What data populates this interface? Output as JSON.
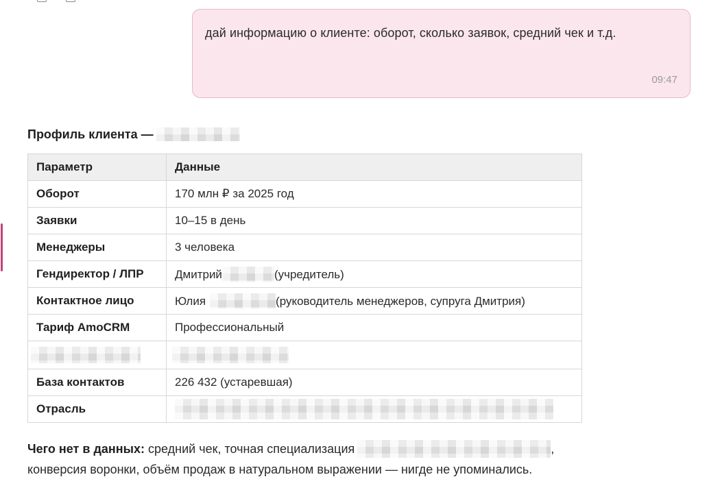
{
  "message": {
    "text": "дай информацию о клиенте: оборот, сколько заявок, средний чек и т.д.",
    "time": "09:47"
  },
  "profile": {
    "heading": "Профиль клиента —"
  },
  "table": {
    "headers": [
      "Параметр",
      "Данные"
    ],
    "rows": [
      {
        "param": "Оборот",
        "value": "170 млн ₽ за 2025 год"
      },
      {
        "param": "Заявки",
        "value": "10–15 в день"
      },
      {
        "param": "Менеджеры",
        "value": "3 человека"
      },
      {
        "param": "Гендиректор / ЛПР",
        "value_before": "Дмитрий",
        "value_after": "(учредитель)"
      },
      {
        "param": "Контактное лицо",
        "value_before": "Юлия",
        "value_after": "(руководитель менеджеров, супруга Дмитрия)"
      },
      {
        "param": "Тариф AmoCRM",
        "value": "Профессиональный"
      },
      {
        "param": "База контактов",
        "value": "226 432 (устаревшая)"
      },
      {
        "param": "Отрасль"
      }
    ]
  },
  "note": {
    "label": "Чего нет в данных:",
    "text_before": "средний чек, точная специализация",
    "text_after": ",",
    "line2": "конверсия воронки, объём продаж в натуральном выражении — нигде не упоминались."
  },
  "colors": {
    "bubble_bg": "#fbe6ed",
    "bubble_border": "#e4b8c7",
    "accent_marker": "#c0437a",
    "table_header_bg": "#efefef"
  }
}
